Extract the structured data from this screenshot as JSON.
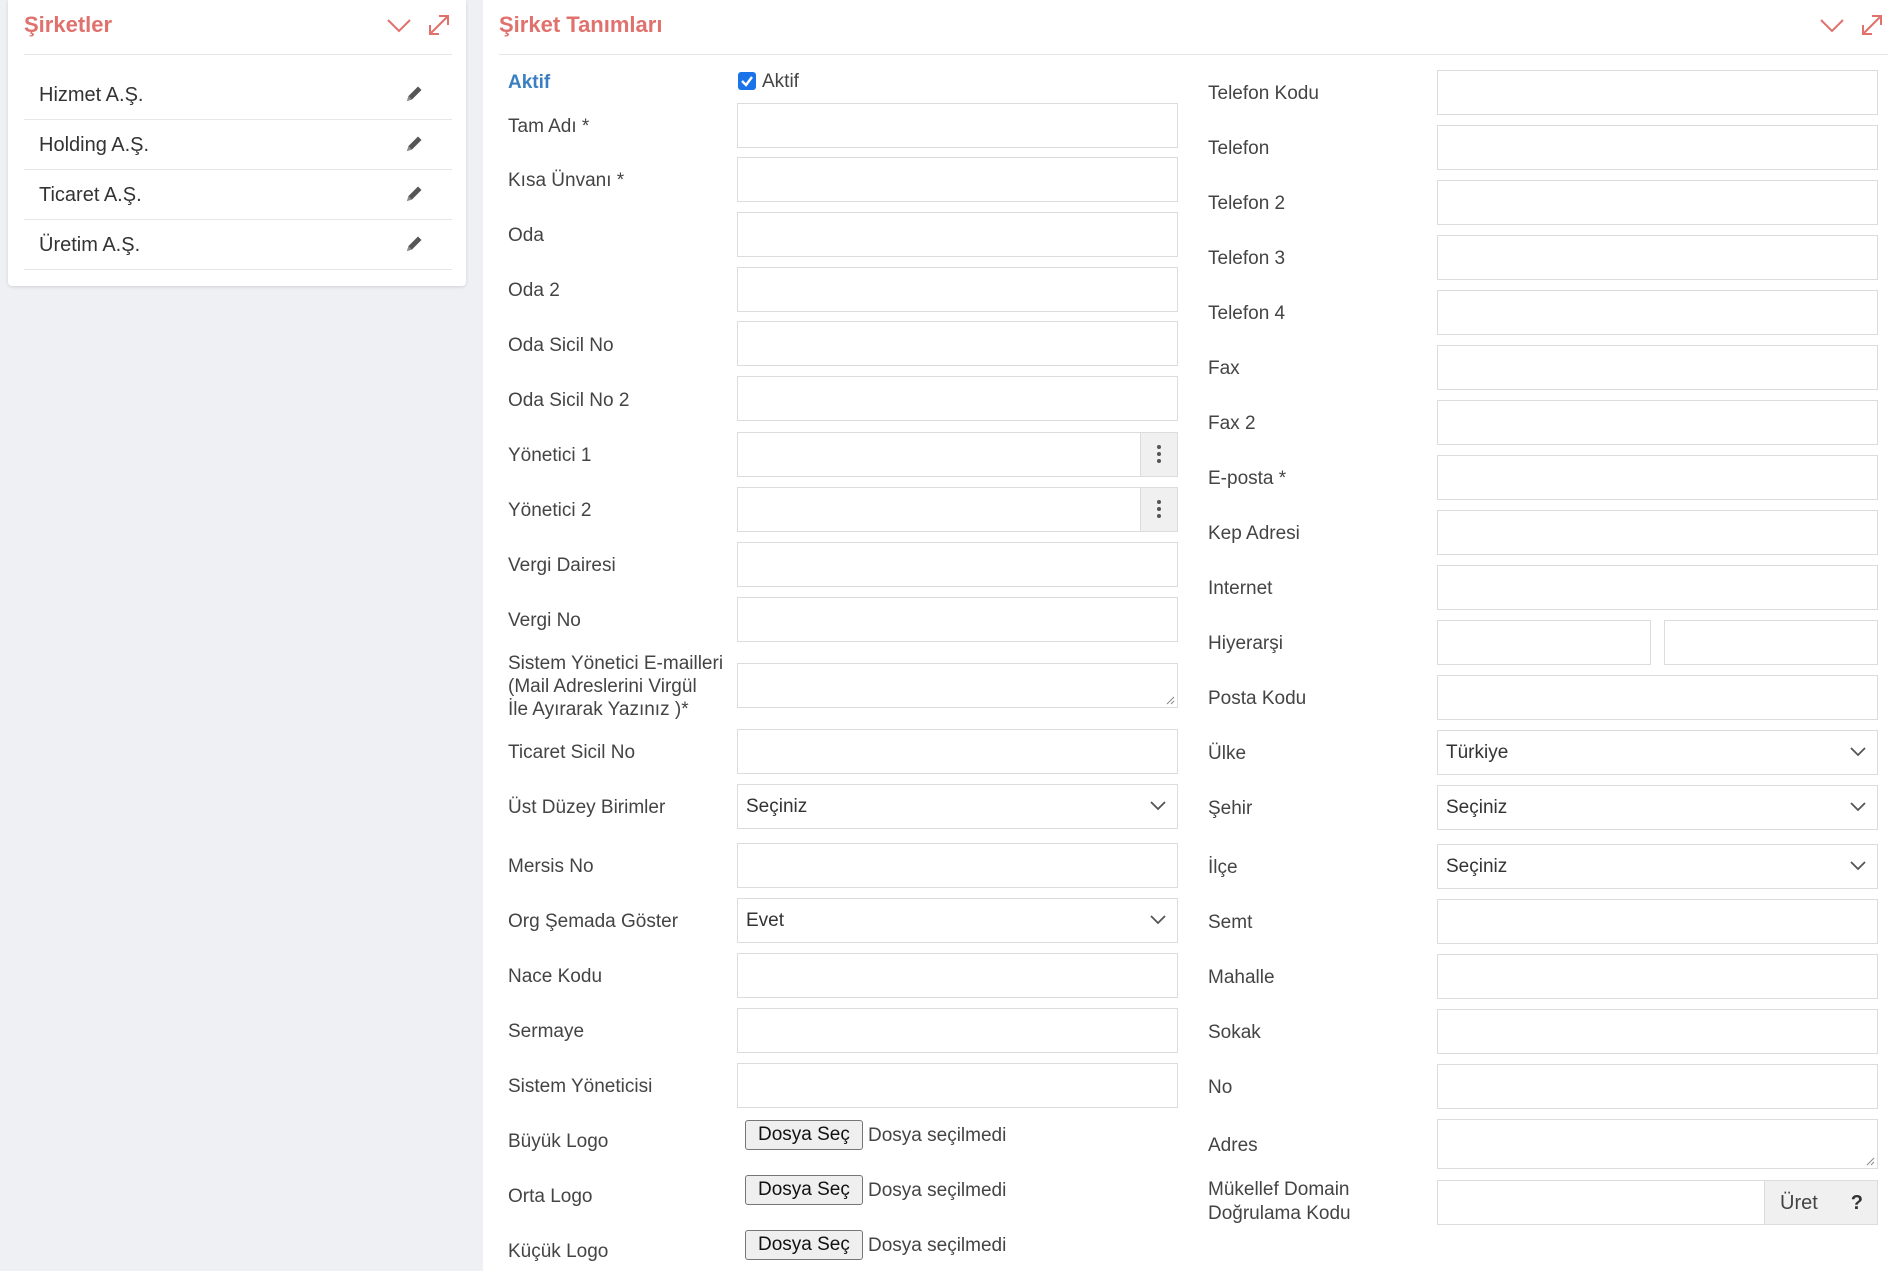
{
  "left_panel": {
    "title": "Şirketler",
    "companies": [
      {
        "name": "Hizmet A.Ş."
      },
      {
        "name": "Holding A.Ş."
      },
      {
        "name": "Ticaret A.Ş."
      },
      {
        "name": "Üretim A.Ş."
      }
    ]
  },
  "right_panel": {
    "title": "Şirket Tanımları"
  },
  "form_left": {
    "aktif_label": "Aktif",
    "aktif_checkbox_label": "Aktif",
    "tam_adi": "Tam Adı *",
    "kisa_unvani": "Kısa Ünvanı *",
    "oda": "Oda",
    "oda2": "Oda 2",
    "oda_sicil_no": "Oda Sicil No",
    "oda_sicil_no2": "Oda Sicil No 2",
    "yonetici1": "Yönetici 1",
    "yonetici2": "Yönetici 2",
    "vergi_dairesi": "Vergi Dairesi",
    "vergi_no": "Vergi No",
    "sistem_emails_1": "Sistem Yönetici E-mailleri",
    "sistem_emails_2": "(Mail Adreslerini Virgül",
    "sistem_emails_3": "İle Ayırarak Yazınız )*",
    "ticaret_sicil_no": "Ticaret Sicil No",
    "ust_duzey_birimler": "Üst Düzey Birimler",
    "ust_duzey_value": "Seçiniz",
    "mersis_no": "Mersis No",
    "org_semada_goster": "Org Şemada Göster",
    "org_semada_value": "Evet",
    "nace_kodu": "Nace Kodu",
    "sermaye": "Sermaye",
    "sistem_yoneticisi": "Sistem Yöneticisi",
    "buyuk_logo": "Büyük Logo",
    "orta_logo": "Orta Logo",
    "kucuk_logo": "Küçük Logo",
    "file_button": "Dosya Seç",
    "file_none": "Dosya seçilmedi"
  },
  "form_right": {
    "telefon_kodu": "Telefon Kodu",
    "telefon": "Telefon",
    "telefon2": "Telefon 2",
    "telefon3": "Telefon 3",
    "telefon4": "Telefon 4",
    "fax": "Fax",
    "fax2": "Fax 2",
    "eposta": "E-posta *",
    "kep_adresi": "Kep Adresi",
    "internet": "Internet",
    "hiyerarsi": "Hiyerarşi",
    "posta_kodu": "Posta Kodu",
    "ulke": "Ülke",
    "ulke_value": "Türkiye",
    "sehir": "Şehir",
    "sehir_value": "Seçiniz",
    "ilce": "İlçe",
    "ilce_value": "Seçiniz",
    "semt": "Semt",
    "mahalle": "Mahalle",
    "sokak": "Sokak",
    "no": "No",
    "adres": "Adres",
    "mukellef_1": "Mükellef Domain",
    "mukellef_2": "Doğrulama Kodu",
    "uret_button": "Üret",
    "help_button": "?"
  },
  "colors": {
    "title": "#e0716c",
    "active_label": "#3a7fc1",
    "checkbox": "#1a73e8"
  }
}
